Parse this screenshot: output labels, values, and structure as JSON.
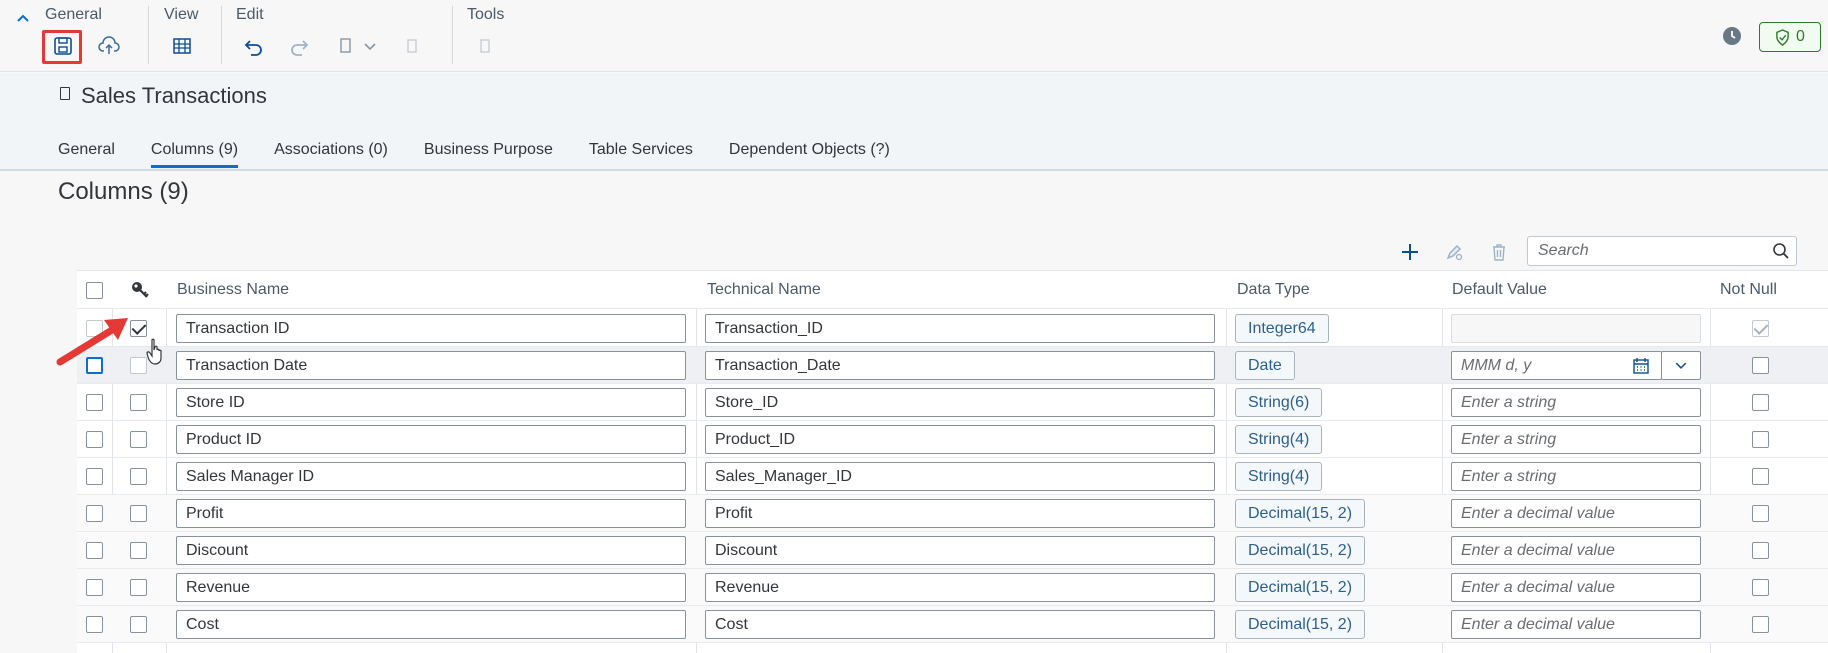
{
  "toolbar": {
    "groups": {
      "general": "General",
      "view": "View",
      "edit": "Edit",
      "tools": "Tools"
    },
    "icons": [
      "chevron-up-icon",
      "save-icon",
      "deploy-icon",
      "grid-view-icon",
      "undo-icon",
      "redo-icon",
      "copy-icon",
      "chevron-down-icon",
      "paste-icon",
      "tool-icon",
      "clock-icon",
      "shield-icon"
    ],
    "validation_count": "0"
  },
  "header": {
    "title": "Sales Transactions",
    "tabs": [
      "General",
      "Columns (9)",
      "Associations (0)",
      "Business Purpose",
      "Table Services",
      "Dependent Objects (?)"
    ],
    "active_tab": "Columns (9)"
  },
  "columns_section": {
    "title": "Columns (9)",
    "search_placeholder": "Search",
    "headers": {
      "key_icon": "key-icon",
      "business_name": "Business Name",
      "technical_name": "Technical Name",
      "data_type": "Data Type",
      "default_value": "Default Value",
      "not_null": "Not Null"
    },
    "rows": [
      {
        "business_name": "Transaction ID",
        "technical_name": "Transaction_ID",
        "data_type": "Integer64",
        "default_value": "",
        "key": true,
        "not_null": true
      },
      {
        "business_name": "Transaction Date",
        "technical_name": "Transaction_Date",
        "data_type": "Date",
        "default_value": "MMM d, y",
        "key": false,
        "not_null": false
      },
      {
        "business_name": "Store ID",
        "technical_name": "Store_ID",
        "data_type": "String(6)",
        "default_value": "Enter a string",
        "key": false,
        "not_null": false
      },
      {
        "business_name": "Product ID",
        "technical_name": "Product_ID",
        "data_type": "String(4)",
        "default_value": "Enter a string",
        "key": false,
        "not_null": false
      },
      {
        "business_name": "Sales Manager ID",
        "technical_name": "Sales_Manager_ID",
        "data_type": "String(4)",
        "default_value": "Enter a string",
        "key": false,
        "not_null": false
      },
      {
        "business_name": "Profit",
        "technical_name": "Profit",
        "data_type": "Decimal(15, 2)",
        "default_value": "Enter a decimal value",
        "key": false,
        "not_null": false
      },
      {
        "business_name": "Discount",
        "technical_name": "Discount",
        "data_type": "Decimal(15, 2)",
        "default_value": "Enter a decimal value",
        "key": false,
        "not_null": false
      },
      {
        "business_name": "Revenue",
        "technical_name": "Revenue",
        "data_type": "Decimal(15, 2)",
        "default_value": "Enter a decimal value",
        "key": false,
        "not_null": false
      },
      {
        "business_name": "Cost",
        "technical_name": "Cost",
        "data_type": "Decimal(15, 2)",
        "default_value": "Enter a decimal value",
        "key": false,
        "not_null": false
      }
    ]
  },
  "colors": {
    "accent": "#0a6ed1",
    "highlight": "#e53935",
    "success": "#2b7d2b"
  }
}
